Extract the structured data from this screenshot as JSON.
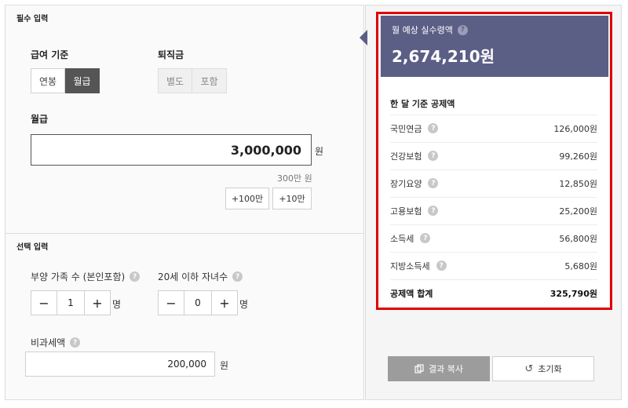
{
  "required": {
    "title": "필수 입력",
    "pay_basis": {
      "label": "급여 기준",
      "options": [
        "연봉",
        "월급"
      ],
      "selected": "월급"
    },
    "severance": {
      "label": "퇴직금",
      "options": [
        "별도",
        "포함"
      ]
    },
    "monthly": {
      "label": "월급",
      "value": "3,000,000",
      "unit": "원",
      "hint": "300만 원",
      "add_buttons": [
        "+100만",
        "+10만"
      ]
    }
  },
  "optional": {
    "title": "선택 입력",
    "dependents": {
      "label": "부양 가족 수 (본인포함)",
      "value": "1",
      "unit": "명"
    },
    "children": {
      "label": "20세 이하 자녀수",
      "value": "0",
      "unit": "명"
    },
    "nontaxable": {
      "label": "비과세액",
      "value": "200,000",
      "unit": "원"
    }
  },
  "result": {
    "title": "월 예상 실수령액",
    "amount": "2,674,210원",
    "deductions_title": "한 달 기준 공제액",
    "deductions": [
      {
        "label": "국민연금",
        "value": "126,000원"
      },
      {
        "label": "건강보험",
        "value": "99,260원"
      },
      {
        "label": "장기요양",
        "value": "12,850원"
      },
      {
        "label": "고용보험",
        "value": "25,200원"
      },
      {
        "label": "소득세",
        "value": "56,800원"
      },
      {
        "label": "지방소득세",
        "value": "5,680원"
      }
    ],
    "total": {
      "label": "공제액 합계",
      "value": "325,790원"
    }
  },
  "actions": {
    "copy": "결과 복사",
    "reset": "초기화"
  },
  "icons": {
    "help": "question-icon",
    "minus": "minus-icon",
    "plus": "plus-icon",
    "copy": "copy-icon",
    "reset": "refresh-icon"
  },
  "colors": {
    "accent": "#5b5e85",
    "highlight": "#e00000",
    "active": "#555555"
  }
}
